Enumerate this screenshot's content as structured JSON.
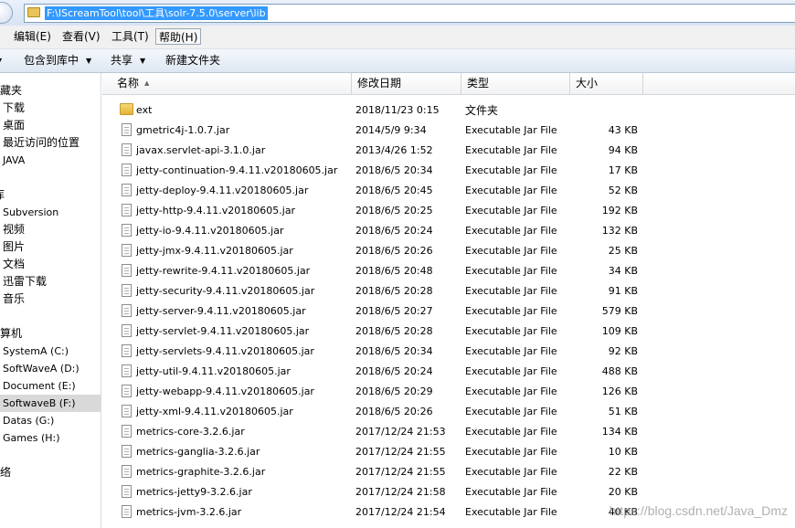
{
  "address": {
    "path": "F:\\IScreamTool\\tool\\工具\\solr-7.5.0\\server\\lib"
  },
  "menu": [
    {
      "label": "编辑(E)"
    },
    {
      "label": "查看(V)"
    },
    {
      "label": "工具(T)"
    },
    {
      "label": "帮助(H)"
    }
  ],
  "toolbar": {
    "include_library": "包含到库中",
    "share": "共享",
    "new_folder": "新建文件夹"
  },
  "nav": {
    "favorites": "收藏夹",
    "downloads": "下载",
    "desktop": "桌面",
    "recent": "最近访问的位置",
    "java": "JAVA",
    "libraries": "库",
    "subversion": "Subversion",
    "videos": "视频",
    "pictures": "图片",
    "documents": "文档",
    "thunder": "迅雷下载",
    "music": "音乐",
    "computer": "计算机",
    "drive_c": "SystemA (C:)",
    "drive_d": "SoftWaveA (D:)",
    "drive_e": "Document (E:)",
    "drive_f": "SoftwaveB (F:)",
    "drive_g": "Datas (G:)",
    "drive_h": "Games (H:)",
    "network": "网络"
  },
  "columns": {
    "name": "名称",
    "date": "修改日期",
    "type": "类型",
    "size": "大小"
  },
  "files": [
    {
      "name": "ext",
      "date": "2018/11/23 0:15",
      "type": "文件夹",
      "size": "",
      "kind": "folder"
    },
    {
      "name": "gmetric4j-1.0.7.jar",
      "date": "2014/5/9 9:34",
      "type": "Executable Jar File",
      "size": "43 KB",
      "kind": "jar"
    },
    {
      "name": "javax.servlet-api-3.1.0.jar",
      "date": "2013/4/26 1:52",
      "type": "Executable Jar File",
      "size": "94 KB",
      "kind": "jar"
    },
    {
      "name": "jetty-continuation-9.4.11.v20180605.jar",
      "date": "2018/6/5 20:34",
      "type": "Executable Jar File",
      "size": "17 KB",
      "kind": "jar"
    },
    {
      "name": "jetty-deploy-9.4.11.v20180605.jar",
      "date": "2018/6/5 20:45",
      "type": "Executable Jar File",
      "size": "52 KB",
      "kind": "jar"
    },
    {
      "name": "jetty-http-9.4.11.v20180605.jar",
      "date": "2018/6/5 20:25",
      "type": "Executable Jar File",
      "size": "192 KB",
      "kind": "jar"
    },
    {
      "name": "jetty-io-9.4.11.v20180605.jar",
      "date": "2018/6/5 20:24",
      "type": "Executable Jar File",
      "size": "132 KB",
      "kind": "jar"
    },
    {
      "name": "jetty-jmx-9.4.11.v20180605.jar",
      "date": "2018/6/5 20:26",
      "type": "Executable Jar File",
      "size": "25 KB",
      "kind": "jar"
    },
    {
      "name": "jetty-rewrite-9.4.11.v20180605.jar",
      "date": "2018/6/5 20:48",
      "type": "Executable Jar File",
      "size": "34 KB",
      "kind": "jar"
    },
    {
      "name": "jetty-security-9.4.11.v20180605.jar",
      "date": "2018/6/5 20:28",
      "type": "Executable Jar File",
      "size": "91 KB",
      "kind": "jar"
    },
    {
      "name": "jetty-server-9.4.11.v20180605.jar",
      "date": "2018/6/5 20:27",
      "type": "Executable Jar File",
      "size": "579 KB",
      "kind": "jar"
    },
    {
      "name": "jetty-servlet-9.4.11.v20180605.jar",
      "date": "2018/6/5 20:28",
      "type": "Executable Jar File",
      "size": "109 KB",
      "kind": "jar"
    },
    {
      "name": "jetty-servlets-9.4.11.v20180605.jar",
      "date": "2018/6/5 20:34",
      "type": "Executable Jar File",
      "size": "92 KB",
      "kind": "jar"
    },
    {
      "name": "jetty-util-9.4.11.v20180605.jar",
      "date": "2018/6/5 20:24",
      "type": "Executable Jar File",
      "size": "488 KB",
      "kind": "jar"
    },
    {
      "name": "jetty-webapp-9.4.11.v20180605.jar",
      "date": "2018/6/5 20:29",
      "type": "Executable Jar File",
      "size": "126 KB",
      "kind": "jar"
    },
    {
      "name": "jetty-xml-9.4.11.v20180605.jar",
      "date": "2018/6/5 20:26",
      "type": "Executable Jar File",
      "size": "51 KB",
      "kind": "jar"
    },
    {
      "name": "metrics-core-3.2.6.jar",
      "date": "2017/12/24 21:53",
      "type": "Executable Jar File",
      "size": "134 KB",
      "kind": "jar"
    },
    {
      "name": "metrics-ganglia-3.2.6.jar",
      "date": "2017/12/24 21:55",
      "type": "Executable Jar File",
      "size": "10 KB",
      "kind": "jar"
    },
    {
      "name": "metrics-graphite-3.2.6.jar",
      "date": "2017/12/24 21:55",
      "type": "Executable Jar File",
      "size": "22 KB",
      "kind": "jar"
    },
    {
      "name": "metrics-jetty9-3.2.6.jar",
      "date": "2017/12/24 21:58",
      "type": "Executable Jar File",
      "size": "20 KB",
      "kind": "jar"
    },
    {
      "name": "metrics-jvm-3.2.6.jar",
      "date": "2017/12/24 21:54",
      "type": "Executable Jar File",
      "size": "40 KB",
      "kind": "jar"
    }
  ],
  "watermark": "https://blog.csdn.net/Java_Dmz"
}
